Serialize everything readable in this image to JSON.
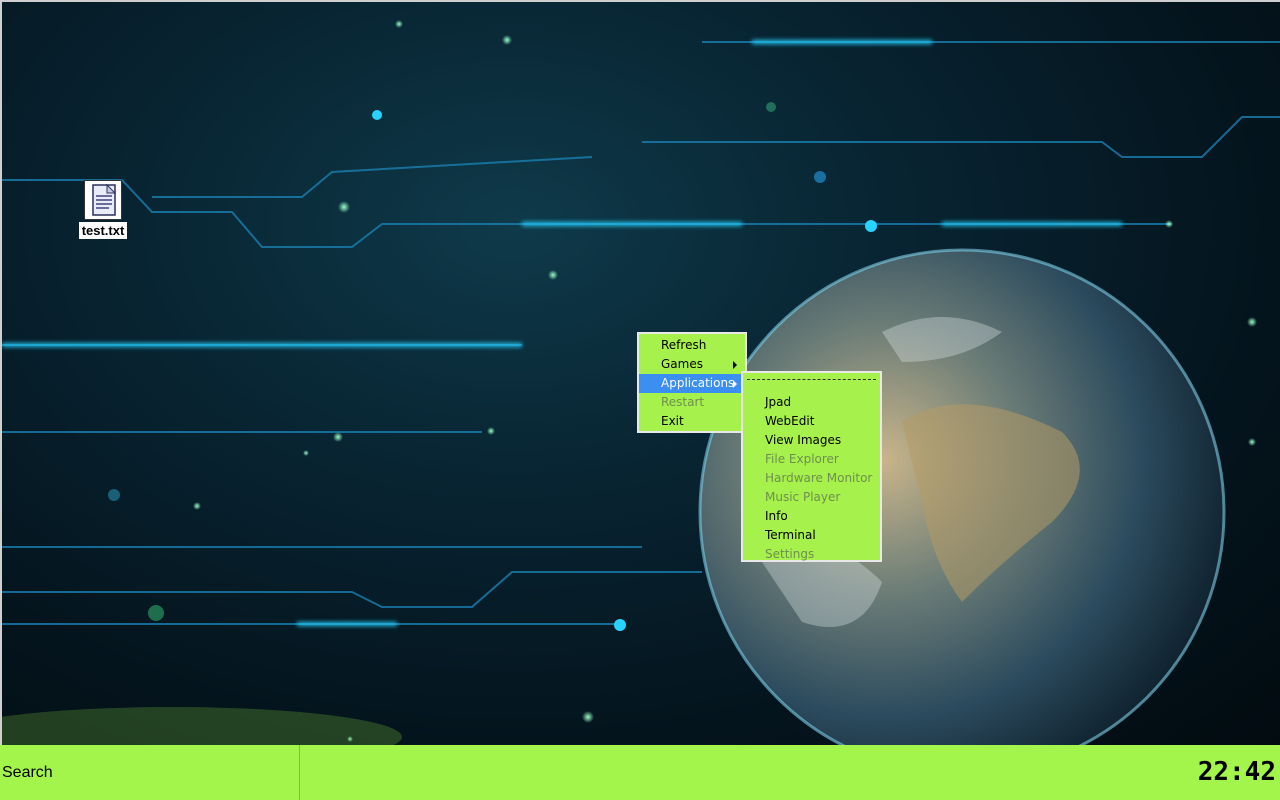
{
  "desktop": {
    "icons": [
      {
        "label": "test.txt",
        "icon": "text-document-icon"
      }
    ]
  },
  "context_menu": {
    "items": [
      {
        "label": "Refresh",
        "disabled": false,
        "has_submenu": false
      },
      {
        "label": "Games",
        "disabled": false,
        "has_submenu": true
      },
      {
        "label": "Applications",
        "disabled": false,
        "has_submenu": true,
        "selected": true
      },
      {
        "label": "Restart",
        "disabled": true,
        "has_submenu": false
      },
      {
        "label": "Exit",
        "disabled": false,
        "has_submenu": false
      }
    ]
  },
  "applications_menu": {
    "items": [
      {
        "label": "Jpad",
        "disabled": false
      },
      {
        "label": "WebEdit",
        "disabled": false
      },
      {
        "label": "View Images",
        "disabled": false
      },
      {
        "label": "File Explorer",
        "disabled": true
      },
      {
        "label": "Hardware Monitor",
        "disabled": true
      },
      {
        "label": "Music Player",
        "disabled": true
      },
      {
        "label": "Info",
        "disabled": false
      },
      {
        "label": "Terminal",
        "disabled": false
      },
      {
        "label": "Settings",
        "disabled": true
      }
    ]
  },
  "taskbar": {
    "search_label": "Search",
    "clock": "22:42"
  },
  "colors": {
    "accent_green": "#a3f54b",
    "menu_selected": "#3a8ff0",
    "wallpaper_glow": "#00c8ff"
  }
}
